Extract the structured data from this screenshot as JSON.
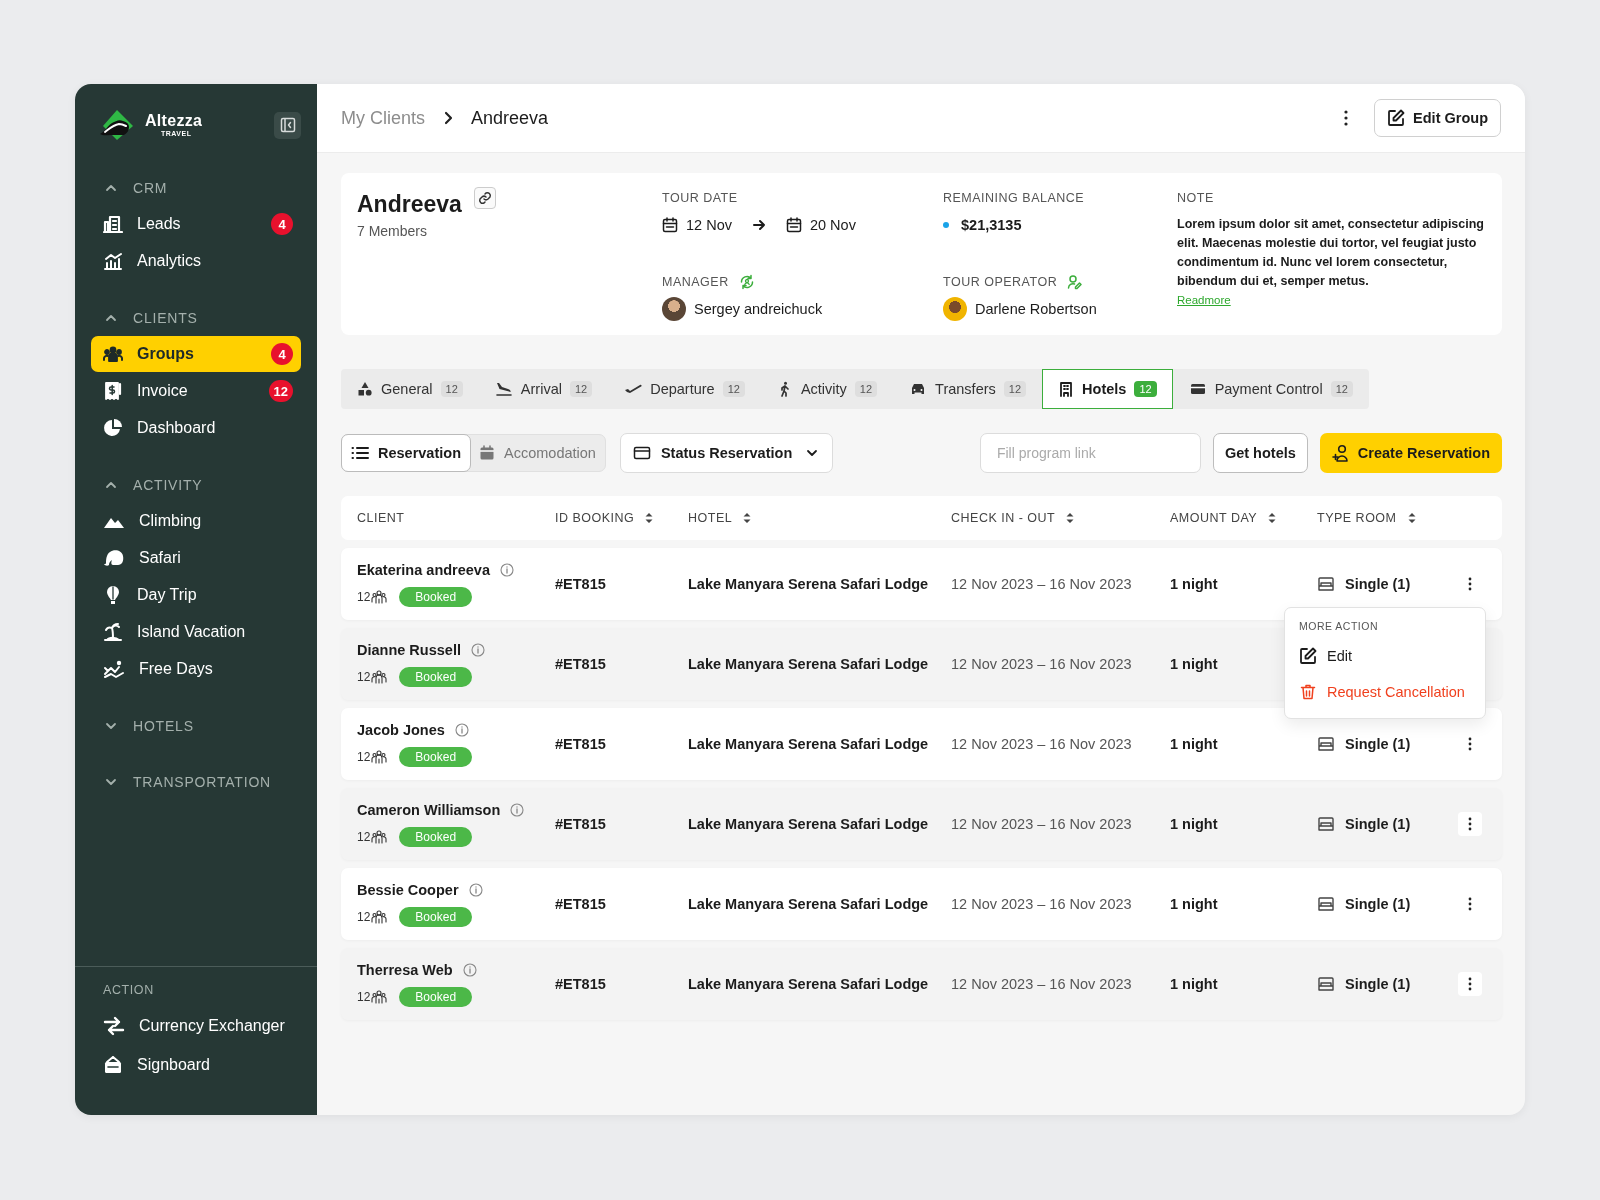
{
  "sidebar": {
    "brand": {
      "name": "Altezza",
      "tagline": "TRAVEL"
    },
    "sections": [
      {
        "title": "CRM",
        "expanded": true,
        "items": [
          {
            "label": "Leads",
            "badge": "4",
            "selected": false
          },
          {
            "label": "Analytics",
            "selected": false
          }
        ]
      },
      {
        "title": "CLIENTS",
        "expanded": true,
        "items": [
          {
            "label": "Groups",
            "badge": "4",
            "selected": true
          },
          {
            "label": "Invoice",
            "badge": "12",
            "selected": false
          },
          {
            "label": "Dashboard",
            "selected": false
          }
        ]
      },
      {
        "title": "ACTIVITY",
        "expanded": true,
        "items": [
          {
            "label": "Climbing",
            "selected": false
          },
          {
            "label": "Safari",
            "selected": false
          },
          {
            "label": "Day Trip",
            "selected": false
          },
          {
            "label": "Island Vacation",
            "selected": false
          },
          {
            "label": "Free Days",
            "selected": false
          }
        ]
      },
      {
        "title": "HOTELS",
        "expanded": false
      },
      {
        "title": "TRANSPORTATION",
        "expanded": false
      }
    ],
    "action": {
      "title": "ACTION",
      "items": [
        {
          "label": "Currency Exchanger"
        },
        {
          "label": "Signboard"
        }
      ]
    }
  },
  "breadcrumb": [
    "My Clients",
    "Andreeva"
  ],
  "edit_button": "Edit Group",
  "group": {
    "name": "Andreeva",
    "members": "7 Members",
    "tour_date": {
      "label": "TOUR DATE",
      "from": "12 Nov",
      "to": "20 Nov"
    },
    "balance": {
      "label": "REMAINING BALANCE",
      "amount": "$21,3135"
    },
    "manager": {
      "label": "MANAGER",
      "name": "Sergey andreichuck"
    },
    "operator": {
      "label": "TOUR OPERATOR",
      "name": "Darlene Robertson"
    },
    "note": {
      "label": "NOTE",
      "text": "Lorem ipsum dolor sit amet, consectetur adipiscing elit. Maecenas molestie dui tortor, vel feugiat justo condimentum id. Nunc vel lorem consectetur, bibendum dui et, semper metus.",
      "link": "Readmore"
    }
  },
  "tabs": [
    {
      "label": "General",
      "count": "12",
      "selected": false
    },
    {
      "label": "Arrival",
      "count": "12",
      "selected": false
    },
    {
      "label": "Departure",
      "count": "12",
      "selected": false
    },
    {
      "label": "Activity",
      "count": "12",
      "selected": false
    },
    {
      "label": "Transfers",
      "count": "12",
      "selected": false
    },
    {
      "label": "Hotels",
      "count": "12",
      "selected": true
    },
    {
      "label": "Payment Control",
      "count": "12",
      "selected": false
    }
  ],
  "views": [
    {
      "label": "Reservation",
      "selected": true
    },
    {
      "label": "Accomodation",
      "selected": false
    }
  ],
  "status_filter": "Status Reservation",
  "program_link": {
    "placeholder": "Fill program link"
  },
  "get_hotels": "Get hotels",
  "create_button": "Create Reservation",
  "table": {
    "columns": [
      {
        "label": "CLIENT",
        "sortable": false
      },
      {
        "label": "ID BOOKING",
        "sortable": true
      },
      {
        "label": "HOTEL",
        "sortable": true
      },
      {
        "label": "CHECK IN - OUT",
        "sortable": true
      },
      {
        "label": "AMOUNT DAY",
        "sortable": true
      },
      {
        "label": "TYPE ROOM",
        "sortable": true
      }
    ],
    "rows": [
      {
        "client": "Ekaterina andreeva",
        "people": "12",
        "status": "Booked",
        "id": "#ET815",
        "hotel": "Lake Manyara Serena Safari Lodge",
        "dates": "12 Nov 2023 – 16 Nov 2023",
        "amount": "1 night",
        "room": "Single (1)"
      },
      {
        "client": "Dianne Russell",
        "people": "12",
        "status": "Booked",
        "id": "#ET815",
        "hotel": "Lake Manyara Serena Safari Lodge",
        "dates": "12 Nov 2023 – 16 Nov 2023",
        "amount": "1 night"
      },
      {
        "client": "Jacob Jones",
        "people": "12",
        "status": "Booked",
        "id": "#ET815",
        "hotel": "Lake Manyara Serena Safari Lodge",
        "dates": "12 Nov 2023 – 16 Nov 2023",
        "amount": "1 night",
        "room": "Single (1)"
      },
      {
        "client": "Cameron Williamson",
        "people": "12",
        "status": "Booked",
        "id": "#ET815",
        "hotel": "Lake Manyara Serena Safari Lodge",
        "dates": "12 Nov 2023 – 16 Nov 2023",
        "amount": "1 night",
        "room": "Single (1)"
      },
      {
        "client": "Bessie Cooper",
        "people": "12",
        "status": "Booked",
        "id": "#ET815",
        "hotel": "Lake Manyara Serena Safari Lodge",
        "dates": "12 Nov 2023 – 16 Nov 2023",
        "amount": "1 night",
        "room": "Single (1)"
      },
      {
        "client": "Therresa Web",
        "people": "12",
        "status": "Booked",
        "id": "#ET815",
        "hotel": "Lake Manyara Serena Safari Lodge",
        "dates": "12 Nov 2023 – 16 Nov 2023",
        "amount": "1 night",
        "room": "Single (1)"
      }
    ]
  },
  "more_action_menu": {
    "title": "MORE ACTION",
    "items": [
      {
        "label": "Edit",
        "kind": "normal"
      },
      {
        "label": "Request Cancellation",
        "kind": "danger"
      }
    ]
  }
}
